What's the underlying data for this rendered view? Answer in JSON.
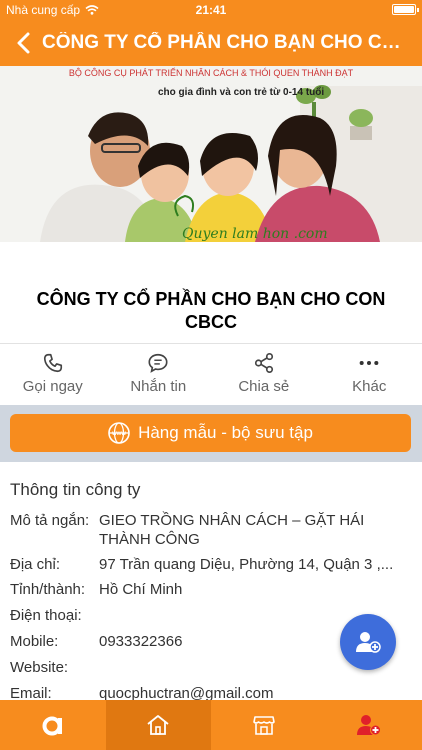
{
  "status_bar": {
    "carrier": "Nhà cung cấp",
    "time": "21:41"
  },
  "nav": {
    "title": "CÔNG TY CỔ PHẦN CHO BẠN CHO CON CBCC"
  },
  "banner": {
    "tagline_top": "BỘ CÔNG CỤ PHÁT TRIỂN NHÂN CÁCH & THÓI QUEN THÀNH ĐẠT",
    "tagline": "cho gia đình và con trẻ từ 0-14 tuổi",
    "logo_text": "Quyen lam hon .com"
  },
  "company": {
    "name": "CÔNG TY CỔ PHẦN CHO BẠN CHO CON CBCC"
  },
  "actions": [
    {
      "label": "Gọi ngay",
      "icon": "phone-icon"
    },
    {
      "label": "Nhắn tin",
      "icon": "message-icon"
    },
    {
      "label": "Chia sẻ",
      "icon": "share-icon"
    },
    {
      "label": "Khác",
      "icon": "more-icon"
    }
  ],
  "sample_button": {
    "label": "Hàng mẫu - bộ sưu tập",
    "icon": "www-icon"
  },
  "info": {
    "title": "Thông tin công ty",
    "rows": [
      {
        "label": "Mô tả ngắn:",
        "value": "GIEO TRỒNG NHÂN CÁCH – GẶT HÁI THÀNH CÔNG"
      },
      {
        "label": "Địa chỉ:",
        "value": "97 Trần quang Diệu, Phường 14, Quận 3 ,..."
      },
      {
        "label": "Tỉnh/thành:",
        "value": "Hồ Chí Minh"
      },
      {
        "label": "Điện thoại:",
        "value": ""
      },
      {
        "label": "Mobile:",
        "value": "0933322366"
      },
      {
        "label": "Website:",
        "value": ""
      },
      {
        "label": "Email:",
        "value": "quocphuctran@gmail.com"
      }
    ]
  },
  "fab": {
    "icon": "add-contact-icon"
  },
  "tabs": [
    {
      "icon": "brand-a-icon",
      "active": false
    },
    {
      "icon": "home-icon",
      "active": true
    },
    {
      "icon": "store-icon",
      "active": false
    },
    {
      "icon": "user-add-icon",
      "active": false
    }
  ],
  "colors": {
    "primary": "#f78c1e",
    "primary_dark": "#e07811",
    "fab": "#3e6ddb",
    "band": "#cfd6df",
    "accent_red": "#e0202a"
  }
}
